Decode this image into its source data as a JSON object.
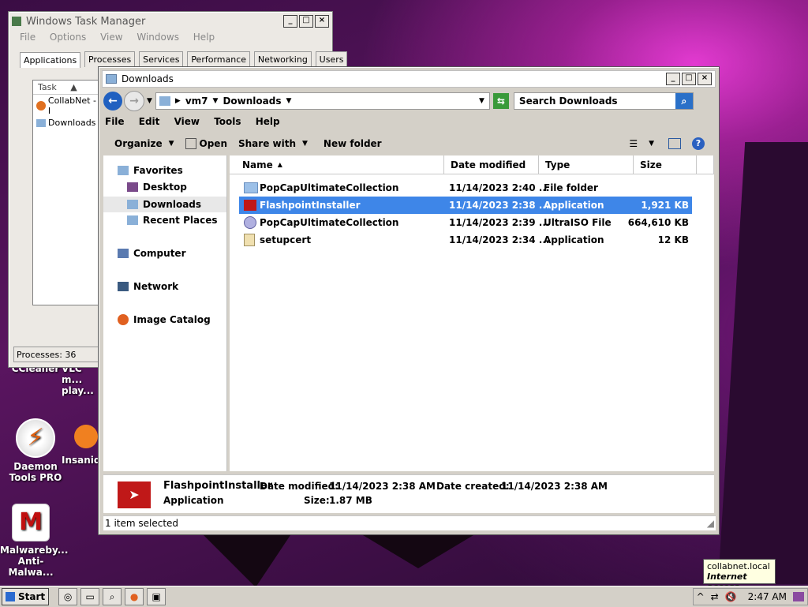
{
  "desktop": {
    "icons": [
      {
        "label": "CCleaner"
      },
      {
        "label": "VLC m... play..."
      },
      {
        "label": "Daemon Tools PRO"
      },
      {
        "label": "Insaniq..."
      },
      {
        "label": "Malwareby... Anti-Malwa..."
      }
    ]
  },
  "task_manager": {
    "title": "Windows Task Manager",
    "menu": [
      "File",
      "Options",
      "View",
      "Windows",
      "Help"
    ],
    "tabs": [
      "Applications",
      "Processes",
      "Services",
      "Performance",
      "Networking",
      "Users"
    ],
    "list_header": "Task",
    "tasks": [
      "CollabNet - I",
      "Downloads"
    ],
    "status": "Processes: 36"
  },
  "explorer": {
    "title": "Downloads",
    "breadcrumb": [
      "vm7",
      "Downloads"
    ],
    "search_placeholder": "Search Downloads",
    "menu": [
      "File",
      "Edit",
      "View",
      "Tools",
      "Help"
    ],
    "commands": {
      "organize": "Organize",
      "open": "Open",
      "share": "Share with",
      "new_folder": "New folder"
    },
    "nav": {
      "favorites": "Favorites",
      "desktop": "Desktop",
      "downloads": "Downloads",
      "recent": "Recent Places",
      "computer": "Computer",
      "network": "Network",
      "catalog": "Image Catalog"
    },
    "columns": {
      "name": "Name",
      "date": "Date modified",
      "type": "Type",
      "size": "Size"
    },
    "files": [
      {
        "name": "PopCapUltimateCollection",
        "date": "11/14/2023 2:40 ...",
        "type": "File folder",
        "size": "",
        "icon": "folder-icon"
      },
      {
        "name": "FlashpointInstaller",
        "date": "11/14/2023 2:38 ...",
        "type": "Application",
        "size": "1,921 KB",
        "icon": "flashpoint-app-icon"
      },
      {
        "name": "PopCapUltimateCollection",
        "date": "11/14/2023 2:39 ...",
        "type": "UltraISO File",
        "size": "664,610 KB",
        "icon": "disc-image-icon"
      },
      {
        "name": "setupcert",
        "date": "11/14/2023 2:34 ...",
        "type": "Application",
        "size": "12 KB",
        "icon": "setup-app-icon"
      }
    ],
    "details": {
      "name": "FlashpointInstaller",
      "type": "Application",
      "modified_label": "Date modified:",
      "modified": "11/14/2023 2:38 AM",
      "created_label": "Date created:",
      "created": "11/14/2023 2:38 AM",
      "size_label": "Size:",
      "size": "1.87 MB"
    },
    "status": "1 item selected"
  },
  "taskbar": {
    "start": "Start",
    "time": "2:47 AM",
    "tooltip_title": "collabnet.local",
    "tooltip_sub": "Internet access"
  },
  "colors": {
    "selection": "#3e86e8",
    "window_bg": "#d4d0c8"
  }
}
